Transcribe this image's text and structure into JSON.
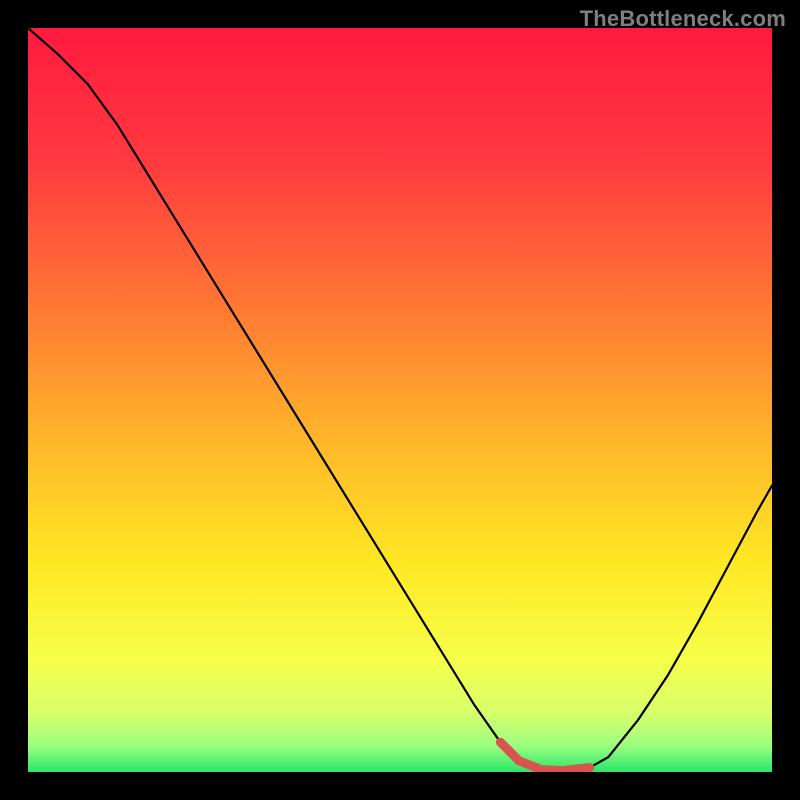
{
  "watermark": "TheBottleneck.com",
  "chart_data": {
    "type": "line",
    "title": "",
    "xlabel": "",
    "ylabel": "",
    "xlim": [
      0,
      100
    ],
    "ylim": [
      0,
      100
    ],
    "grid": false,
    "legend": false,
    "series": [
      {
        "name": "curve",
        "color": "#000000",
        "x": [
          0,
          4,
          8,
          12,
          16,
          20,
          24,
          28,
          32,
          36,
          40,
          44,
          48,
          52,
          56,
          60,
          63.5,
          66,
          69,
          72,
          75.5,
          78,
          82,
          86,
          90,
          94,
          98,
          100
        ],
        "y": [
          100,
          96.5,
          92.5,
          87,
          80.5,
          74,
          67.5,
          61,
          54.5,
          48,
          41.5,
          35,
          28.5,
          22,
          15.5,
          9,
          4,
          1.5,
          0.3,
          0.2,
          0.6,
          2,
          7,
          13,
          20,
          27.5,
          35,
          38.5
        ]
      },
      {
        "name": "optimal-band",
        "color": "#d9534f",
        "x": [
          63.5,
          66,
          69,
          72,
          75.5
        ],
        "y": [
          4,
          1.5,
          0.3,
          0.2,
          0.6
        ]
      }
    ],
    "background_gradient": {
      "stops": [
        {
          "offset": 0.0,
          "color": "#ff1a3f"
        },
        {
          "offset": 0.18,
          "color": "#ff3a3f"
        },
        {
          "offset": 0.38,
          "color": "#ff7a33"
        },
        {
          "offset": 0.56,
          "color": "#ffb82a"
        },
        {
          "offset": 0.72,
          "color": "#ffe824"
        },
        {
          "offset": 0.85,
          "color": "#f7ff4a"
        },
        {
          "offset": 0.92,
          "color": "#d8ff6a"
        },
        {
          "offset": 0.965,
          "color": "#9bff80"
        },
        {
          "offset": 1.0,
          "color": "#28e66a"
        }
      ]
    }
  }
}
